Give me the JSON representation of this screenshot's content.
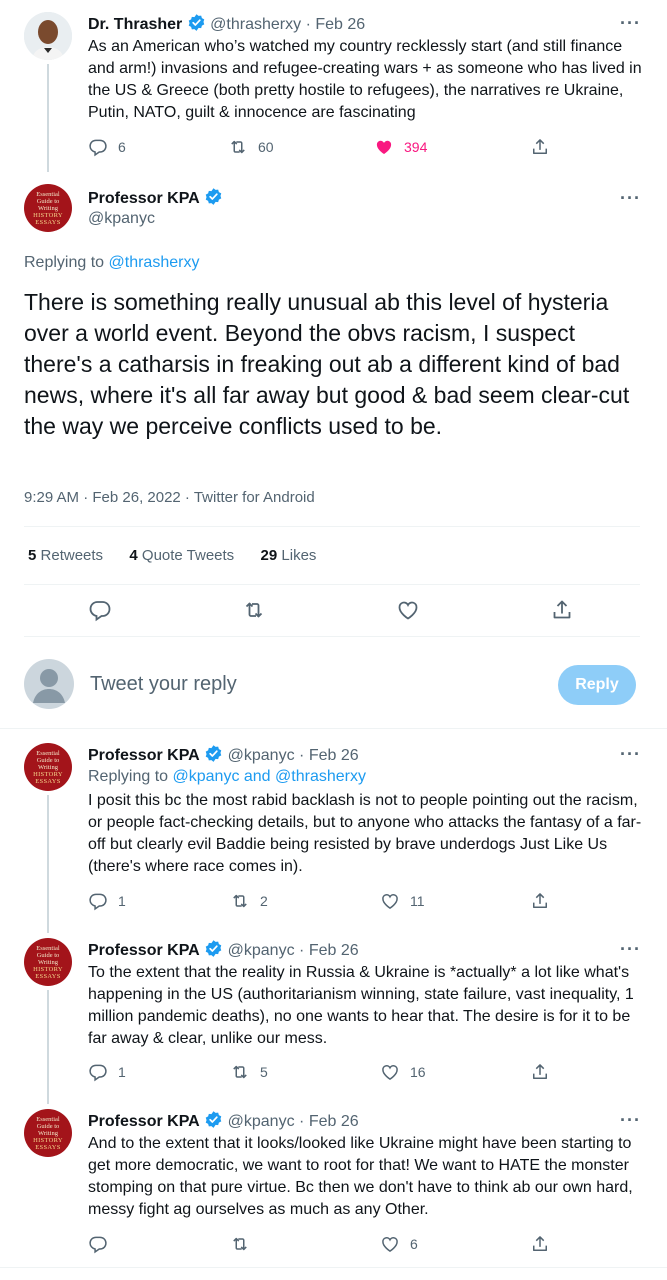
{
  "parent_tweet": {
    "name": "Dr. Thrasher",
    "handle": "@thrasherxy",
    "date": "Feb 26",
    "text": "As an American who’s watched my country recklessly start (and still finance and arm!) invasions and refugee-creating wars + as someone who has lived in the US & Greece (both pretty hostile to refugees), the narratives re Ukraine, Putin, NATO, guilt & innocence are fascinating",
    "replies": "6",
    "retweets": "60",
    "likes": "394"
  },
  "main_tweet": {
    "name": "Professor KPA",
    "handle": "@kpanyc",
    "replying_prefix": "Replying to",
    "replying_to": "@thrasherxy",
    "text": "There is something really unusual ab this level of hysteria over a world event. Beyond the obvs racism, I suspect there's a catharsis in freaking out ab a different kind of bad news, where it's all far away but good & bad seem clear-cut the way we perceive conflicts used to be.",
    "timestamp": "9:29 AM · Feb 26, 2022 · Twitter for Android",
    "retweets_count": "5",
    "retweets_label": "Retweets",
    "quotes_count": "4",
    "quotes_label": "Quote Tweets",
    "likes_count": "29",
    "likes_label": "Likes"
  },
  "avatar_text": {
    "line1": "Essential",
    "line2": "Guide to",
    "line3": "Writing",
    "line4": "HISTORY",
    "line5": "ESSAYS"
  },
  "composer": {
    "placeholder": "Tweet your reply",
    "button": "Reply"
  },
  "replies": [
    {
      "name": "Professor KPA",
      "handle": "@kpanyc",
      "date": "Feb 26",
      "replying_prefix": "Replying to",
      "replying_to": "@kpanyc and @thrasherxy",
      "text": "I posit this bc the most rabid backlash is not to people pointing out the racism, or people fact-checking details, but to anyone who attacks the fantasy of a far-off but clearly evil Baddie being resisted by brave underdogs Just Like Us (there's where race comes in).",
      "replies": "1",
      "retweets": "2",
      "likes": "11"
    },
    {
      "name": "Professor KPA",
      "handle": "@kpanyc",
      "date": "Feb 26",
      "text": "To the extent that the reality in Russia & Ukraine is *actually* a lot like what's happening in the US (authoritarianism winning, state failure, vast inequality, 1 million pandemic deaths), no one wants to hear that. The desire is for it to be far away & clear, unlike our mess.",
      "replies": "1",
      "retweets": "5",
      "likes": "16"
    },
    {
      "name": "Professor KPA",
      "handle": "@kpanyc",
      "date": "Feb 26",
      "text": "And to the extent that it looks/looked like Ukraine might have been starting to  get more democratic, we want to root for that! We want to HATE the monster stomping on that pure virtue. Bc then we don't have to think ab our own hard, messy fight ag ourselves as much as any Other.",
      "replies": "",
      "retweets": "",
      "likes": "6"
    }
  ],
  "colors": {
    "accent": "#1d9bf0",
    "like": "#f91880",
    "muted": "#536471",
    "text": "#0f1419"
  }
}
